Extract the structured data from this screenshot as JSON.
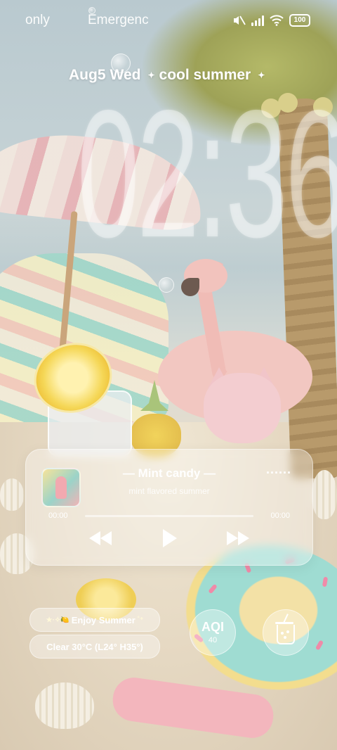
{
  "status_bar": {
    "carrier_1": "only",
    "carrier_2": "Emergenc",
    "battery": "100",
    "icons": [
      "mute-icon",
      "signal-icon",
      "wifi-icon",
      "battery-icon"
    ]
  },
  "lock": {
    "date": "Aug5",
    "weekday": "Wed",
    "motto": "cool summer",
    "time": "02:36"
  },
  "music": {
    "title": "— Mint candy —",
    "subtitle": "mint flavored summer",
    "more": "......",
    "elapsed": "00:00",
    "duration": "00:00",
    "progress_fraction": 0.0,
    "controls": [
      "previous-icon",
      "play-icon",
      "next-icon"
    ]
  },
  "widgets": {
    "greeting": "Enjoy Summer",
    "weather": "Clear 30°C (L24° H35°)",
    "aqi_label": "AQI",
    "aqi_value": "40",
    "drink_icon": "drink-cup-icon"
  },
  "colors": {
    "glass": "#ffffff",
    "flamingo": "#f2c7c1",
    "ring_mint": "#9fdcd2",
    "lemon": "#f5d757"
  }
}
